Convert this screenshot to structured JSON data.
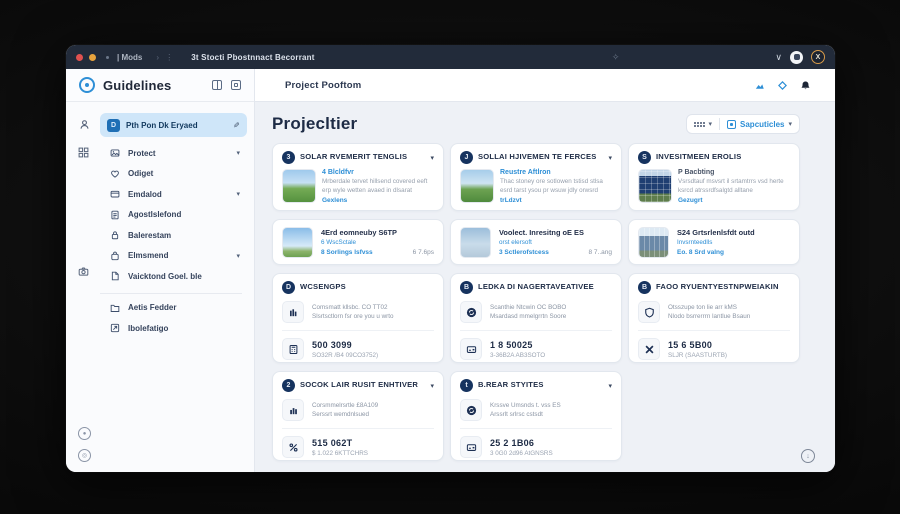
{
  "titlebar": {
    "menu_label": "| Mods",
    "tab_title": "3t Stocti Pbostnnact Becorrant",
    "separator_glyphs": "› ⋮",
    "chevron": "∨",
    "avatar_orange_glyph": "X"
  },
  "sidebar": {
    "title": "Guidelines",
    "active_item": {
      "label": "Pth Pon Dk Eryaed",
      "icon": "badge-square",
      "edit_icon": "pencil"
    },
    "items": [
      {
        "label": "Protect",
        "icon": "picture",
        "chevron": "▾"
      },
      {
        "label": "Odiget",
        "icon": "heart",
        "chevron": ""
      },
      {
        "label": "Emdalod",
        "icon": "wallet",
        "chevron": "▾"
      },
      {
        "label": "Agostlslefond",
        "icon": "document",
        "chevron": ""
      },
      {
        "label": "Balerestam",
        "icon": "lock",
        "chevron": ""
      },
      {
        "label": "Elmsmend",
        "icon": "bag",
        "chevron": "▾"
      },
      {
        "label": "Vaicktond Goel. ble",
        "icon": "page",
        "chevron": ""
      }
    ],
    "footer_items": [
      {
        "label": "Aetis Fedder",
        "icon": "folder"
      },
      {
        "label": "Ibolefatigo",
        "icon": "tag"
      }
    ],
    "rail_icons": [
      "person",
      "grid",
      "camera"
    ],
    "bottom_icons": [
      "help-circle",
      "settings-circle"
    ]
  },
  "topbar": {
    "title": "Project Pooftom",
    "icons": [
      "cloud",
      "diamond",
      "bell"
    ]
  },
  "main": {
    "page_title": "Projecltier",
    "toolbar": {
      "grid_button_chevron": "▾",
      "specs_label": "Sapcuticles",
      "specs_chevron": "▾"
    },
    "project_cards": [
      {
        "badge": "3",
        "title": "SOLAR RVEMERIT TENGLIS",
        "chevron": "▾",
        "thumb": "field",
        "subtitle": "4 Blcldfvr",
        "description": "Mrberdale tervet hillsend covered eeft erp wyle wetten avaed in dlsarat",
        "link": "Gexlens"
      },
      {
        "badge": "J",
        "title": "SOLLAI HJIVEMEN TE FERCES",
        "chevron": "▾",
        "thumb": "field2",
        "subtitle": "Reustre Aftlron",
        "description": "Thac stoney ore sotlowen tstisd stlsa esrd tarst ysou pr wsuw jdly orwsrd",
        "link": "trLdzvt"
      },
      {
        "badge": "S",
        "title": "INVESITMEEN EROLIS",
        "chevron": "",
        "thumb": "panels",
        "subtitle": "P Bacbting",
        "description": "Vsrsdtauf msvsrt il srtamtrrs vsd herte ksrcd atrssrdfsalgtd alltane",
        "link": "Gezugrt"
      }
    ],
    "mini_cards": [
      {
        "title": "4Erd eomneuby S6TP",
        "line1": "6 WscSctale",
        "line2": "8 Sorlings lsfvss",
        "value": "6 7.6ps",
        "thumb": "sky"
      },
      {
        "title": "Voolect. Inresitng oE ES",
        "line1": "orst elersoft",
        "line2": "3 Sctlerofstcess",
        "value": "8 7..ang",
        "thumb": "clouds"
      },
      {
        "title": "S24 Grtsrlenlsfdt outd",
        "line1": "Invsrnteedlls",
        "line2": "Eo. 8 Srd valng",
        "value": "",
        "thumb": "panels2"
      }
    ],
    "stat_cards": [
      {
        "badge": "D",
        "title": "WCSENGPS",
        "chevron": "",
        "info_icon": "books",
        "info_line1": "Comsmatt kllsbc. CO TT02",
        "info_line2": "Slsrtsctlorn fsr ore you u wrto",
        "stat_icon": "calculator",
        "stat_value": "500 3099",
        "stat_caption": "SO32R /B4 09CO3752)"
      },
      {
        "badge": "B",
        "title": "LEDKA DI NAGERTAVEATIVEE",
        "chevron": "",
        "info_icon": "refresh-circle",
        "info_line1": "Scanthie Ntcwin OC BOBO",
        "info_line2": "Msardasd mmelgrrtn Soore",
        "stat_icon": "card",
        "stat_value": "1 8 50025",
        "stat_caption": "3-36B2A AB3SOTO"
      },
      {
        "badge": "B",
        "title": "FAOO RYUENTYESTNPWEIAKIN",
        "chevron": "",
        "info_icon": "shield",
        "info_line1": "Otsszupe ton lie arr kMS",
        "info_line2": "Nlodo bsrrerrrn lantlue Bsaun",
        "stat_icon": "cross",
        "stat_value": "15 6 5B00",
        "stat_caption": "SLJR (SAASTURTB)"
      },
      {
        "badge": "2",
        "title": "SOCOK LAIR RUSIT ENHTIVER",
        "chevron": "▾",
        "info_icon": "bars",
        "info_line1": "Corsmmelrsrtle £8A109",
        "info_line2": "Serssrt wemdnlsued",
        "stat_icon": "percent",
        "stat_value": "515 062T",
        "stat_caption": "$ 1.022 6KTTCHRS"
      },
      {
        "badge": "t",
        "title": "B.REAR STYITES",
        "chevron": "▾",
        "info_icon": "refresh-circle",
        "info_line1": "Krssve Umsnds t. vss ES",
        "info_line2": "Arssrlt srlrsc cstsdt",
        "stat_icon": "card",
        "stat_value": "25 2 1B06",
        "stat_caption": "3 0G0 2d96 AtGNSRS"
      }
    ]
  },
  "colors": {
    "accent_blue": "#2e8fd6",
    "navy": "#16335f",
    "titlebar": "#222b3a",
    "card_border": "#e2e7ee",
    "bg": "#eef1f6"
  }
}
